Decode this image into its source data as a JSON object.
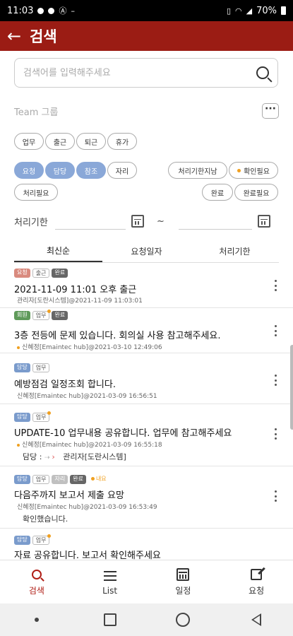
{
  "status_bar": {
    "time": "11:03",
    "battery": "70%"
  },
  "header": {
    "title": "검색"
  },
  "search": {
    "placeholder": "검색어를 입력해주세요"
  },
  "team": {
    "label": "Team 그룹",
    "more": "···"
  },
  "category_chips": [
    "업무",
    "출근",
    "퇴근",
    "휴가"
  ],
  "role_chips": [
    "요청",
    "담당",
    "참조",
    "자리"
  ],
  "status_chips": [
    "처리기한지남",
    "확인필요",
    "처리필요",
    "완료",
    "완료필요"
  ],
  "deadline": {
    "label": "처리기한",
    "separator": "~"
  },
  "tabs": [
    "최신순",
    "요청일자",
    "처리기한"
  ],
  "items": [
    {
      "tags": [
        "요청",
        "출근",
        "완료"
      ],
      "title": "2021-11-09 11:01 오후 출근",
      "meta": "관리자[도란시스템]@2021-11-09 11:03:01"
    },
    {
      "tags": [
        "회원",
        "업무",
        "완료"
      ],
      "title": "3층 전등에 문제 있습니다. 회의실 사용 참고해주세요.",
      "meta": "신혜정[Emaintec hub]@2021-03-10 12:49:06"
    },
    {
      "tags": [
        "담당",
        "업무"
      ],
      "title": "예방점검 일정조회 합니다.",
      "meta": "신혜정[Emaintec hub]@2021-03-09 16:56:51"
    },
    {
      "tags": [
        "담당",
        "업무"
      ],
      "title": "UPDATE-10 업무내용 공유합니다. 업무에 참고해주세요",
      "meta": "신혜정[Emaintec hub]@2021-03-09 16:55:18",
      "extra_label": "담당 :",
      "extra_value": "관리자[도란시스템]"
    },
    {
      "tags": [
        "담당",
        "업무",
        "자리",
        "완료",
        "내요"
      ],
      "title": "다음주까지 보고서 제출 요망",
      "meta": "신혜정[Emaintec hub]@2021-03-09 16:53:49",
      "extra": "확인했습니다."
    },
    {
      "tags": [
        "담당",
        "업무"
      ],
      "title": "자료 공유합니다. 보고서 확인해주세요"
    }
  ],
  "bottom_nav": [
    "검색",
    "List",
    "일정",
    "요청"
  ],
  "colors": {
    "header": "#9b1c14",
    "selected_chip": "#8aa8d8",
    "active_nav": "#b01e16"
  }
}
